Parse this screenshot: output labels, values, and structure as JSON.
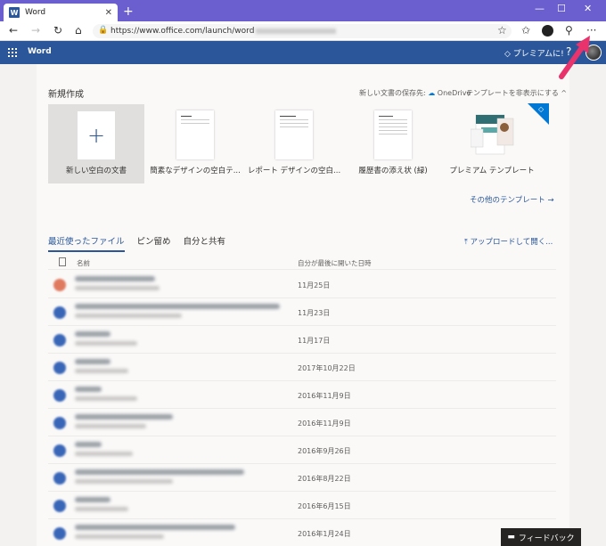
{
  "browser": {
    "tab_title": "Word",
    "url": "https://www.office.com/launch/word",
    "controls": {
      "minimize": "—",
      "maximize": "☐",
      "close": "✕"
    }
  },
  "appbar": {
    "app_name": "Word",
    "premium_label": "プレミアムに!",
    "help": "?"
  },
  "new_doc": {
    "title": "新規作成",
    "save_location_label": "新しい文書の保存先:",
    "save_location_value": "OneDrive",
    "hide_templates": "テンプレートを非表示にする ^",
    "templates": [
      {
        "label": "新しい空白の文書"
      },
      {
        "label": "簡素なデザインの空白テ..."
      },
      {
        "label": "レポート デザインの空白..."
      },
      {
        "label": "履歴書の添え状 (緑)"
      },
      {
        "label": "プレミアム テンプレート"
      }
    ],
    "more_templates": "その他のテンプレート →"
  },
  "recent": {
    "tabs": [
      "最近使ったファイル",
      "ピン留め",
      "自分と共有"
    ],
    "upload": "⤒ アップロードして開く...",
    "col_name": "名前",
    "col_date": "自分が最後に開いた日時",
    "rows": [
      {
        "date": "11月25日",
        "icon_color": "#e07a5f"
      },
      {
        "date": "11月23日",
        "icon_color": "#3a66b8"
      },
      {
        "date": "11月17日",
        "icon_color": "#3a66b8"
      },
      {
        "date": "2017年10月22日",
        "icon_color": "#3a66b8"
      },
      {
        "date": "2016年11月9日",
        "icon_color": "#3a66b8"
      },
      {
        "date": "2016年11月9日",
        "icon_color": "#3a66b8"
      },
      {
        "date": "2016年9月26日",
        "icon_color": "#3a66b8"
      },
      {
        "date": "2016年8月22日",
        "icon_color": "#3a66b8"
      },
      {
        "date": "2016年6月15日",
        "icon_color": "#3a66b8"
      },
      {
        "date": "2016年1月24日",
        "icon_color": "#3a66b8"
      }
    ]
  },
  "feedback": "フィードバック"
}
